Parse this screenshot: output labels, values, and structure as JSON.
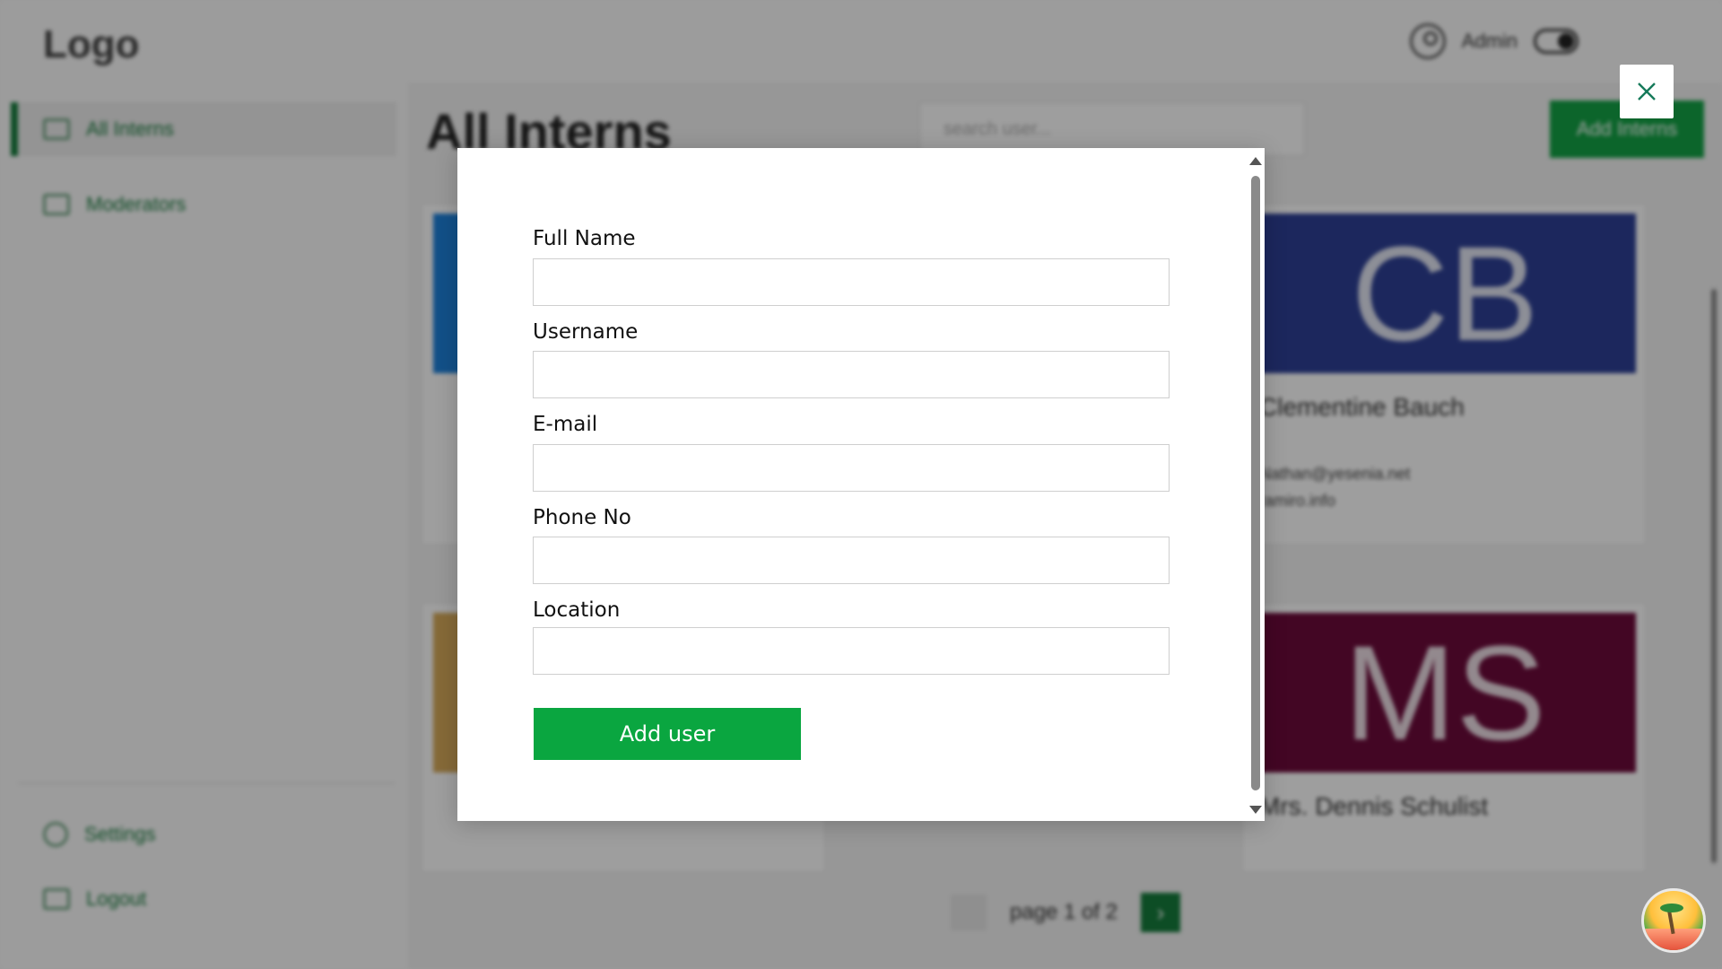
{
  "header": {
    "logo": "Logo",
    "user_name": "Admin"
  },
  "sidebar": {
    "items": [
      {
        "label": "All Interns",
        "active": true
      },
      {
        "label": "Moderators",
        "active": false
      }
    ],
    "bottom_items": [
      {
        "label": "Settings"
      },
      {
        "label": "Logout"
      }
    ]
  },
  "main": {
    "title": "All Interns",
    "search_placeholder": "search user...",
    "add_button": "Add Interns",
    "cards": [
      {
        "initials": "",
        "color": "#1e7fd8",
        "name": "",
        "line1": "",
        "line2": ""
      },
      {
        "initials": "CB",
        "color": "#2d3f94",
        "name": "Clementine Bauch",
        "line1": "Nathan@yesenia.net",
        "line2": "ramiro.info"
      },
      {
        "initials": "",
        "color": "#d4a85a",
        "name": "",
        "line1": "",
        "line2": ""
      },
      {
        "initials": "MS",
        "color": "#6b0b3a",
        "name": "Mrs. Dennis Schulist",
        "line1": "",
        "line2": ""
      }
    ],
    "pagination": {
      "label": "page 1 of 2",
      "next": "›"
    }
  },
  "modal": {
    "fields": [
      {
        "label": "Full Name",
        "value": "",
        "placeholder": ""
      },
      {
        "label": "Username",
        "value": "",
        "placeholder": ""
      },
      {
        "label": "E-mail",
        "value": "",
        "placeholder": ""
      },
      {
        "label": "Phone No",
        "value": "",
        "placeholder": ""
      },
      {
        "label": "Location",
        "value": "",
        "placeholder": ""
      }
    ],
    "submit_label": "Add user"
  },
  "colors": {
    "accent": "#0aa640",
    "sidebar_active": "#157a3b",
    "close_icon": "#157a5a",
    "overlay": "rgba(0,0,0,0.37)"
  },
  "icons": {
    "close": "close-icon",
    "user": "user-circle-icon",
    "theme": "theme-toggle-icon",
    "floating": "beach-palm-icon"
  }
}
